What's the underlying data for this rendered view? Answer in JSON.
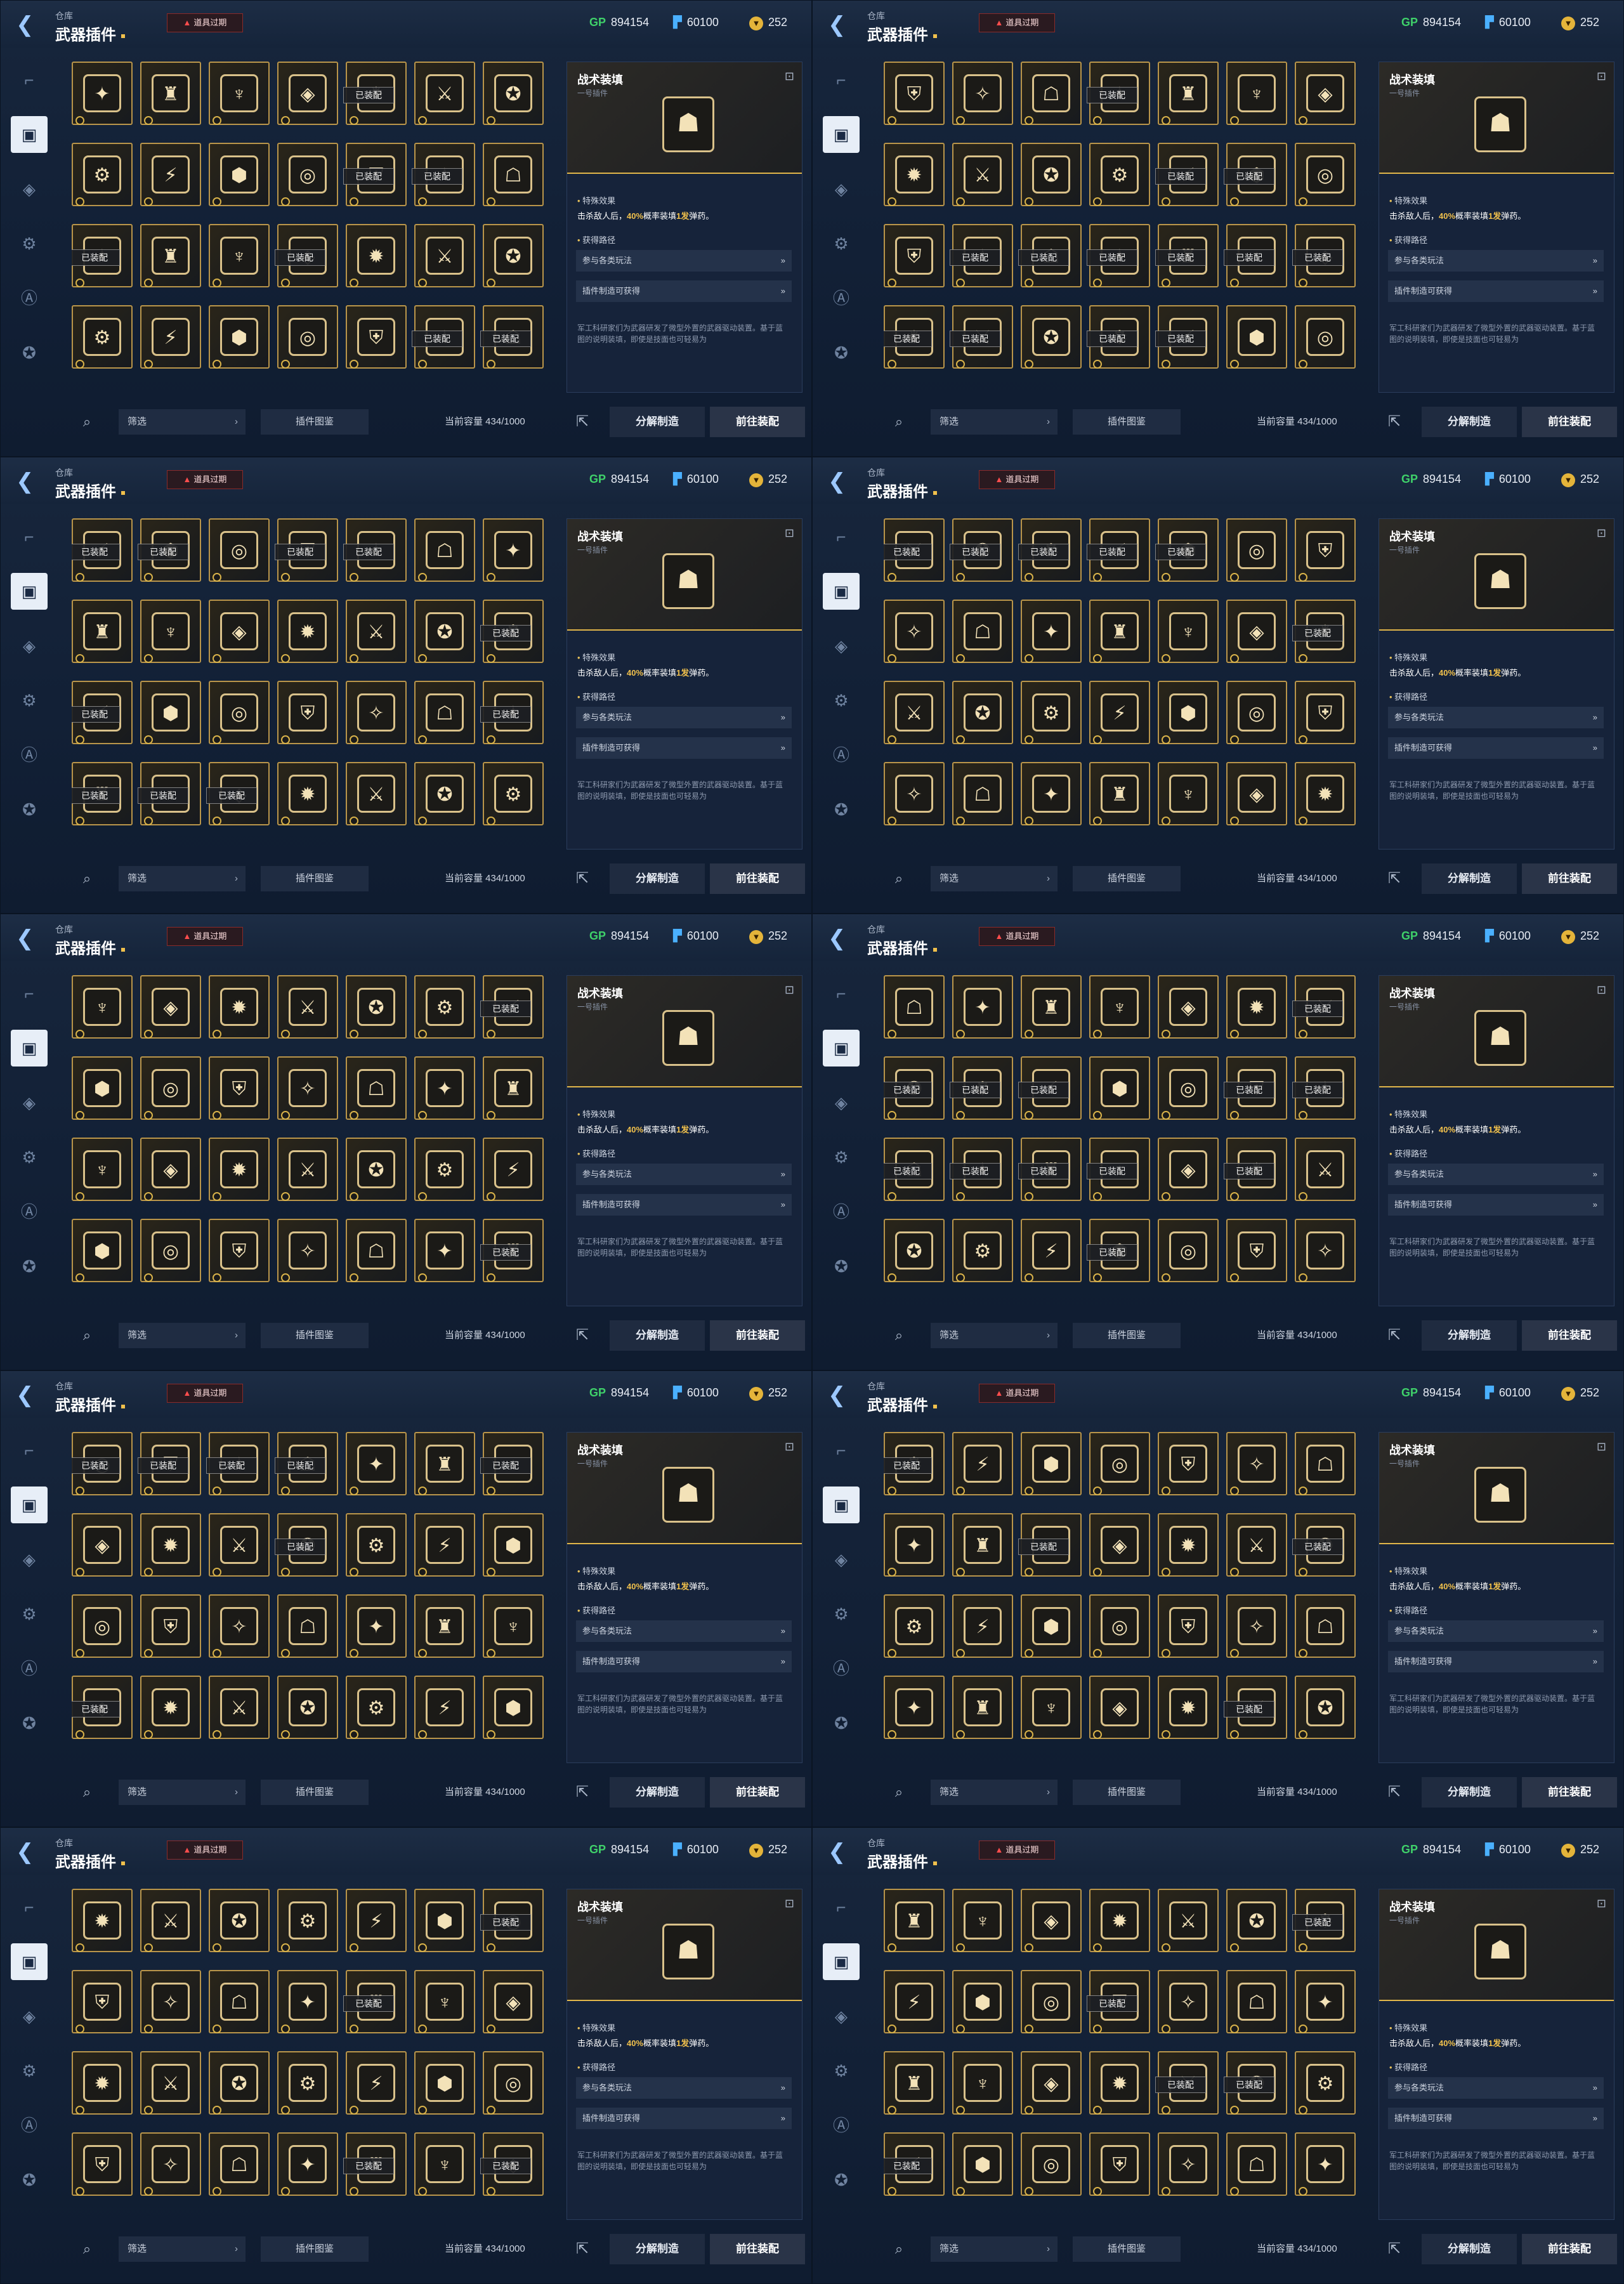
{
  "screen": {
    "crumb": "仓库",
    "title": "武器插件",
    "expired_notice": "道具过期",
    "warn_icon": "warning-icon",
    "currency": {
      "gp_icon": "GP",
      "gp": "894154",
      "ticket": "60100",
      "gold": "252"
    },
    "sidebar_icons": [
      "gun-icon",
      "plugin-icon",
      "attachment-icon",
      "rifle-icon",
      "badge-icon",
      "emblem-icon"
    ],
    "inventory_slots_per_panel": 28,
    "equipped_label": "已装配",
    "detail": {
      "name": "战术装填",
      "subtitle": "一号插件",
      "section_effect": "特殊效果",
      "effect_prefix": "击杀敌人后，",
      "effect_rate": "40%",
      "effect_mid": "概率装填",
      "effect_count": "1发",
      "effect_suffix": "弹药。",
      "section_route": "获得路径",
      "routes": [
        "参与各类玩法",
        "插件制造可获得"
      ],
      "description": "军工科研家们为武器研发了微型外置的武器驱动装置。基于蓝图的说明装填，即使是技面也可轻易为"
    },
    "bottom": {
      "filter_label": "筛选",
      "atlas_label": "插件图鉴",
      "capacity": "当前容量 434/1000",
      "dismantle_label": "分解制造",
      "goto_label": "前往装配"
    }
  },
  "panels": [
    {
      "equipped": [
        4,
        11,
        12,
        14,
        17,
        26,
        27
      ]
    },
    {
      "equipped": [
        3,
        11,
        12,
        15,
        16,
        17,
        18,
        19,
        20,
        21,
        22,
        24,
        25
      ]
    },
    {
      "equipped": [
        0,
        1,
        3,
        4,
        13,
        14,
        20,
        21,
        22,
        23
      ]
    },
    {
      "equipped": [
        0,
        1,
        2,
        3,
        4,
        13
      ]
    },
    {
      "equipped": [
        6,
        27
      ]
    },
    {
      "equipped": [
        6,
        7,
        8,
        9,
        12,
        13,
        14,
        15,
        16,
        17,
        19,
        24
      ]
    },
    {
      "equipped": [
        0,
        1,
        2,
        3,
        6,
        10,
        21
      ]
    },
    {
      "equipped": [
        0,
        9,
        13,
        26
      ]
    },
    {
      "equipped": [
        6,
        11,
        25,
        27
      ]
    },
    {
      "equipped": [
        6,
        10,
        18,
        19,
        21
      ]
    }
  ],
  "icon_glyphs": [
    "✦",
    "⚔",
    "◎",
    "♜",
    "✪",
    "⛨",
    "♆",
    "⚙",
    "✧",
    "◈",
    "⚡",
    "☖",
    "✹",
    "⬢"
  ]
}
